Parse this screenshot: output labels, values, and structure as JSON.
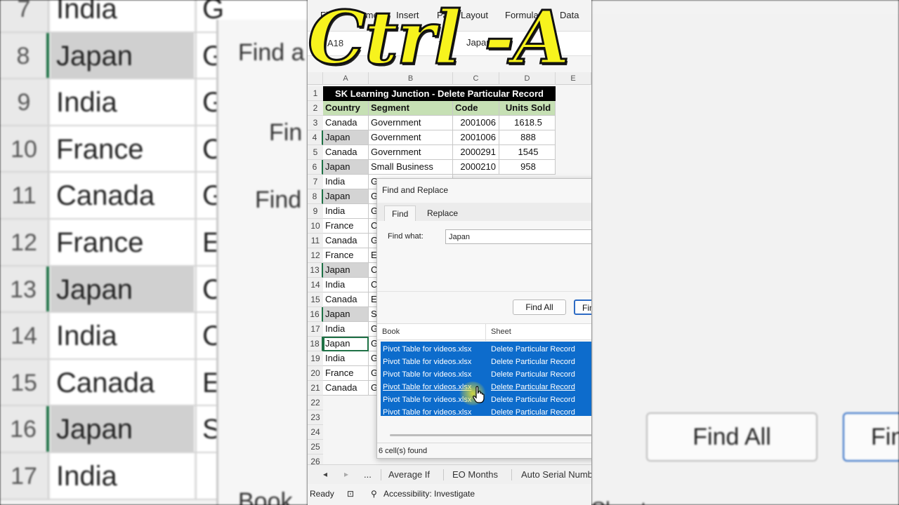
{
  "overlay_title": "Ctrl -A",
  "ribbon": {
    "tabs": [
      "File",
      "Home",
      "Insert",
      "Page Layout",
      "Formulas",
      "Data"
    ]
  },
  "formula_bar": {
    "name_box": "A18",
    "fx": "fx",
    "value": "Japan"
  },
  "columns": [
    "A",
    "B",
    "C",
    "D",
    "E"
  ],
  "sheet": {
    "title": "SK Learning Junction - Delete Particular Record",
    "headers": [
      "Country",
      "Segment",
      "Code",
      "Units Sold"
    ],
    "rows": [
      {
        "num": "3",
        "country": "Canada",
        "segment": "Government",
        "code": "2001006",
        "units": "1618.5"
      },
      {
        "num": "4",
        "country": "Japan",
        "segment": "Government",
        "code": "2001006",
        "units": "888"
      },
      {
        "num": "5",
        "country": "Canada",
        "segment": "Government",
        "code": "2000291",
        "units": "1545"
      },
      {
        "num": "6",
        "country": "Japan",
        "segment": "Small Business",
        "code": "2000210",
        "units": "958"
      },
      {
        "num": "7",
        "country": "India",
        "segment": "G"
      },
      {
        "num": "8",
        "country": "Japan",
        "segment": "G"
      },
      {
        "num": "9",
        "country": "India",
        "segment": "G"
      },
      {
        "num": "10",
        "country": "France",
        "segment": "C"
      },
      {
        "num": "11",
        "country": "Canada",
        "segment": "G"
      },
      {
        "num": "12",
        "country": "France",
        "segment": "E"
      },
      {
        "num": "13",
        "country": "Japan",
        "segment": "C"
      },
      {
        "num": "14",
        "country": "India",
        "segment": "C"
      },
      {
        "num": "15",
        "country": "Canada",
        "segment": "E"
      },
      {
        "num": "16",
        "country": "Japan",
        "segment": "S"
      },
      {
        "num": "17",
        "country": "India",
        "segment": "G"
      },
      {
        "num": "18",
        "country": "Japan",
        "segment": "G"
      },
      {
        "num": "19",
        "country": "India",
        "segment": "G"
      },
      {
        "num": "20",
        "country": "France",
        "segment": "G"
      },
      {
        "num": "21",
        "country": "Canada",
        "segment": "G"
      }
    ],
    "empty_rows": [
      "22",
      "23",
      "24",
      "25",
      "26"
    ]
  },
  "dialog": {
    "title": "Find and Replace",
    "tabs": [
      "Find",
      "Replace"
    ],
    "find_label": "Find what:",
    "find_value": "Japan",
    "buttons": {
      "find_all": "Find All",
      "find_next": "Find Next"
    },
    "results_headers": {
      "book": "Book",
      "sheet": "Sheet"
    },
    "results": [
      {
        "book": "Pivot Table for videos.xlsx",
        "sheet": "Delete Particular Record"
      },
      {
        "book": "Pivot Table for videos.xlsx",
        "sheet": "Delete Particular Record"
      },
      {
        "book": "Pivot Table for videos.xlsx",
        "sheet": "Delete Particular Record"
      },
      {
        "book": "Pivot Table for videos.xlsx",
        "sheet": "Delete Particular Record"
      },
      {
        "book": "Pivot Table for videos.xlsx",
        "sheet": "Delete Particular Record"
      },
      {
        "book": "Pivot Table for videos.xlsx",
        "sheet": "Delete Particular Record"
      }
    ],
    "status": "6 cell(s) found"
  },
  "sheet_tabs": {
    "more": "...",
    "tabs": [
      "Average If",
      "EO Months",
      "Auto Serial Numbers"
    ]
  },
  "statusbar": {
    "ready": "Ready",
    "accessibility": "Accessibility: Investigate"
  },
  "background_left": {
    "rows": [
      {
        "num": "7",
        "text": "India",
        "c2": "G"
      },
      {
        "num": "8",
        "text": "Japan",
        "c2": "G"
      },
      {
        "num": "9",
        "text": "India",
        "c2": "G"
      },
      {
        "num": "10",
        "text": "France",
        "c2": "C"
      },
      {
        "num": "11",
        "text": "Canada",
        "c2": "G"
      },
      {
        "num": "12",
        "text": "France",
        "c2": "E"
      },
      {
        "num": "13",
        "text": "Japan",
        "c2": "C"
      },
      {
        "num": "14",
        "text": "India",
        "c2": "C"
      },
      {
        "num": "15",
        "text": "Canada",
        "c2": "E"
      },
      {
        "num": "16",
        "text": "Japan",
        "c2": "S"
      },
      {
        "num": "17",
        "text": "India",
        "c2": ""
      }
    ],
    "dialog_labels": [
      "Find a",
      "Fin",
      "Find"
    ],
    "book_label": "Book"
  },
  "background_right": {
    "find_all": "Find All",
    "find_next": "Fin",
    "sheet_label": "Sheet"
  }
}
